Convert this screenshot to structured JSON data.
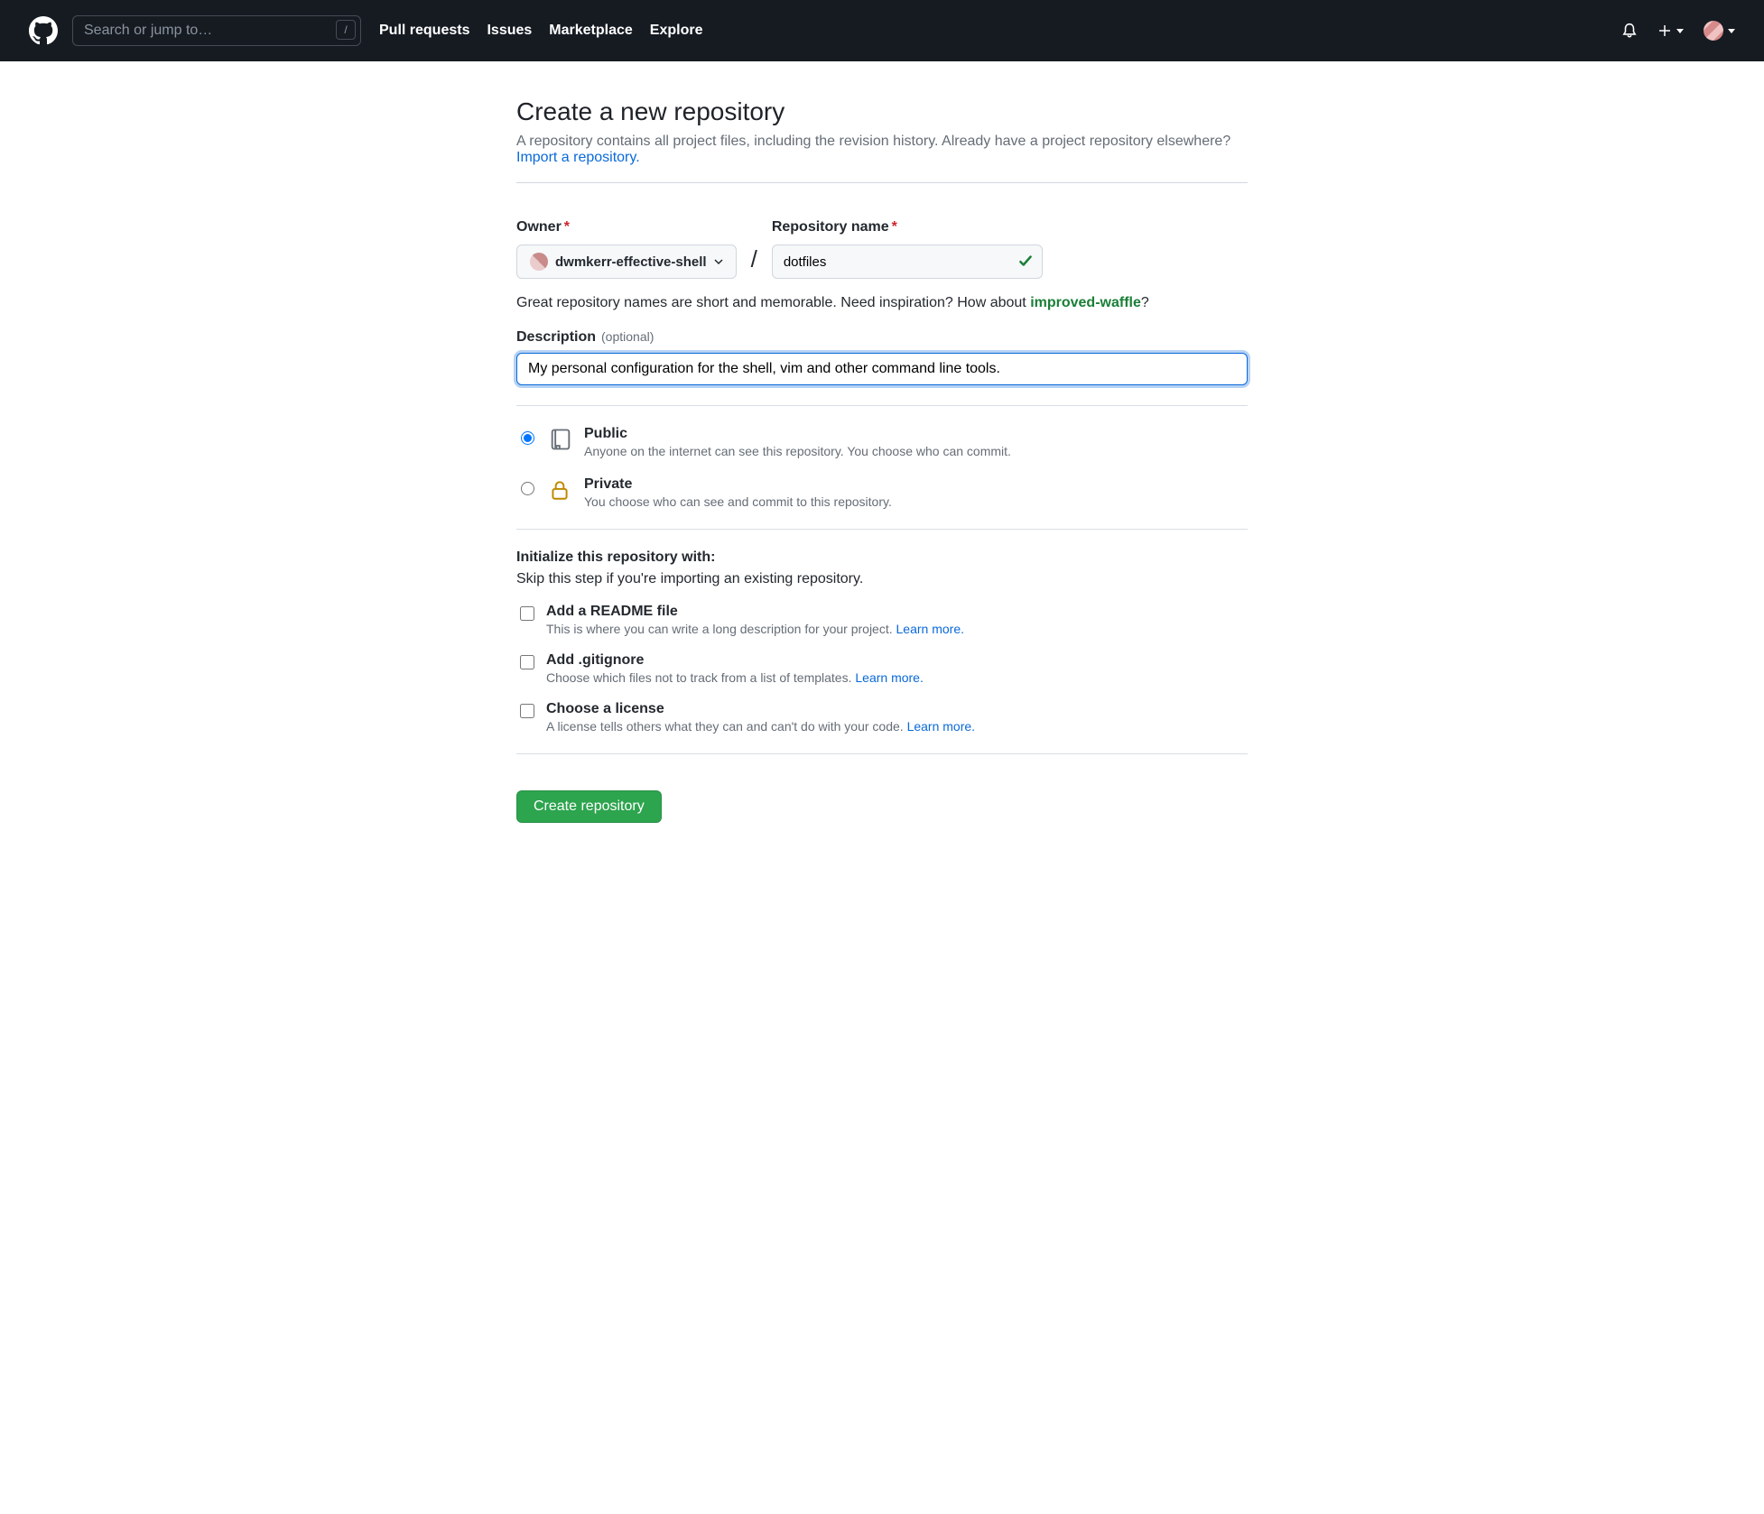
{
  "header": {
    "search_placeholder": "Search or jump to…",
    "slash_key": "/",
    "nav": {
      "pull_requests": "Pull requests",
      "issues": "Issues",
      "marketplace": "Marketplace",
      "explore": "Explore"
    }
  },
  "page": {
    "title": "Create a new repository",
    "subtitle_pre": "A repository contains all project files, including the revision history. Already have a project repository elsewhere? ",
    "import_link": "Import a repository."
  },
  "owner": {
    "label": "Owner",
    "value": "dwmkerr-effective-shell"
  },
  "repo": {
    "label": "Repository name",
    "value": "dotfiles"
  },
  "hint": {
    "text_main": "Great repository names are short and memorable. Need inspiration? How about ",
    "suggestion": "improved-waffle",
    "q": "?"
  },
  "description": {
    "label": "Description",
    "optional": "(optional)",
    "value": "My personal configuration for the shell, vim and other command line tools."
  },
  "visibility": {
    "public": {
      "title": "Public",
      "sub": "Anyone on the internet can see this repository. You choose who can commit."
    },
    "private": {
      "title": "Private",
      "sub": "You choose who can see and commit to this repository."
    }
  },
  "init": {
    "header": "Initialize this repository with:",
    "sub": "Skip this step if you're importing an existing repository.",
    "readme": {
      "title": "Add a README file",
      "sub_pre": "This is where you can write a long description for your project. ",
      "learn": "Learn more."
    },
    "gitignore": {
      "title": "Add .gitignore",
      "sub_pre": "Choose which files not to track from a list of templates. ",
      "learn": "Learn more."
    },
    "license": {
      "title": "Choose a license",
      "sub_pre": "A license tells others what they can and can't do with your code. ",
      "learn": "Learn more."
    }
  },
  "submit": {
    "label": "Create repository"
  }
}
